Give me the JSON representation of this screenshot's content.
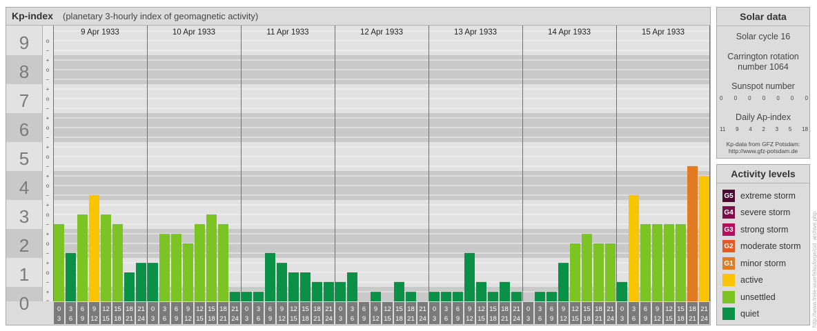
{
  "header": {
    "title": "Kp-index",
    "subtitle": "(planetary 3-hourly index of geomagnetic activity)"
  },
  "chart_data": {
    "type": "bar",
    "title": "Kp-index",
    "subtitle": "(planetary 3-hourly index of geomagnetic activity)",
    "days": [
      "9 Apr 1933",
      "10 Apr 1933",
      "11 Apr 1933",
      "12 Apr 1933",
      "13 Apr 1933",
      "14 Apr 1933",
      "15 Apr 1933"
    ],
    "interval_start_labels": [
      "0",
      "3",
      "6",
      "9",
      "12",
      "15",
      "18",
      "21"
    ],
    "interval_end_labels": [
      "3",
      "6",
      "9",
      "12",
      "15",
      "18",
      "21",
      "24"
    ],
    "y_major_ticks": [
      "0",
      "1",
      "2",
      "3",
      "4",
      "5",
      "6",
      "7",
      "8",
      "9"
    ],
    "y_minor_ticks": [
      "−",
      "o",
      "+"
    ],
    "ylim": [
      0,
      9
    ],
    "grid": true,
    "values": [
      [
        2.67,
        1.67,
        3.0,
        3.67,
        3.0,
        2.67,
        1.0,
        1.33
      ],
      [
        1.33,
        2.33,
        2.33,
        2.0,
        2.67,
        3.0,
        2.67,
        0.33
      ],
      [
        0.33,
        0.33,
        1.67,
        1.33,
        1.0,
        1.0,
        0.67,
        0.67
      ],
      [
        0.67,
        1.0,
        0.0,
        0.33,
        0.0,
        0.67,
        0.33,
        0.0
      ],
      [
        0.33,
        0.33,
        0.33,
        1.67,
        0.67,
        0.33,
        0.67,
        0.33
      ],
      [
        0.0,
        0.33,
        0.33,
        1.33,
        2.0,
        2.33,
        2.0,
        2.0
      ],
      [
        0.67,
        3.67,
        2.67,
        2.67,
        2.67,
        2.67,
        4.67,
        4.33
      ]
    ],
    "category_colors": {
      "quiet": "#0a9147",
      "unsettled": "#7cc424",
      "active": "#f9c400",
      "minor_storm": "#e07b21",
      "moderate_storm": "#de5a27",
      "strong_storm": "#b0125e",
      "severe_storm": "#7a0f49",
      "extreme_storm": "#4d0a33"
    }
  },
  "solar": {
    "title": "Solar data",
    "cycle": "Solar cycle 16",
    "carrington_line1": "Carrington rotation",
    "carrington_line2": "number 1064",
    "sunspot_label": "Sunspot number",
    "sunspot_values": [
      "0",
      "0",
      "0",
      "0",
      "0",
      "0",
      "0"
    ],
    "ap_label": "Daily Ap-index",
    "ap_values": [
      "11",
      "9",
      "4",
      "2",
      "3",
      "5",
      "18"
    ],
    "source_line1": "Kp-data from GFZ Potsdam:",
    "source_line2": "http://www.gfz-potsdam.de"
  },
  "activity": {
    "title": "Activity levels",
    "items": [
      {
        "badge": "G5",
        "label": "extreme storm",
        "color": "#4d0a33"
      },
      {
        "badge": "G4",
        "label": "severe storm",
        "color": "#7a0f49"
      },
      {
        "badge": "G3",
        "label": "strong storm",
        "color": "#b0125e"
      },
      {
        "badge": "G2",
        "label": "moderate storm",
        "color": "#de5a27"
      },
      {
        "badge": "G1",
        "label": "minor storm",
        "color": "#e07b21"
      },
      {
        "badge": "",
        "label": "active",
        "color": "#f9c400"
      },
      {
        "badge": "",
        "label": "unsettled",
        "color": "#7cc424"
      },
      {
        "badge": "",
        "label": "quiet",
        "color": "#0a9147"
      }
    ]
  },
  "credit": "http://www.freie-wuerfelsuforge/cid_archive.php"
}
